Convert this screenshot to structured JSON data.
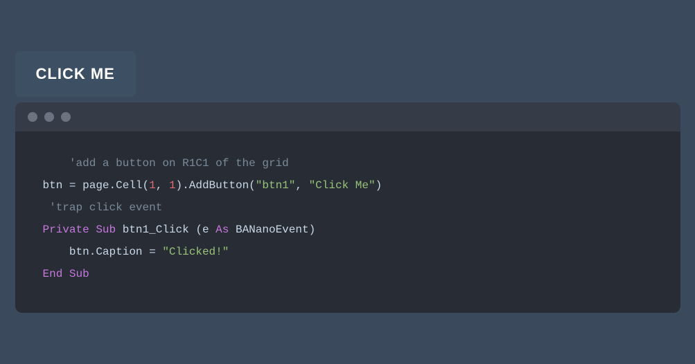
{
  "button": {
    "label": "CLICK ME"
  },
  "code_panel": {
    "dots": [
      "dot1",
      "dot2",
      "dot3"
    ],
    "lines": [
      {
        "type": "comment",
        "text": "    'add a button on R1C1 of the grid"
      },
      {
        "type": "code",
        "text": "btn = page.Cell(1, 1).AddButton(\"btn1\", \"Click Me\")"
      },
      {
        "type": "comment",
        "text": " 'trap click event"
      },
      {
        "type": "code",
        "text": "Private Sub btn1_Click (e As BANanoEvent)"
      },
      {
        "type": "code",
        "text": "    btn.Caption = \"Clicked!\""
      },
      {
        "type": "code",
        "text": "End Sub"
      }
    ]
  }
}
